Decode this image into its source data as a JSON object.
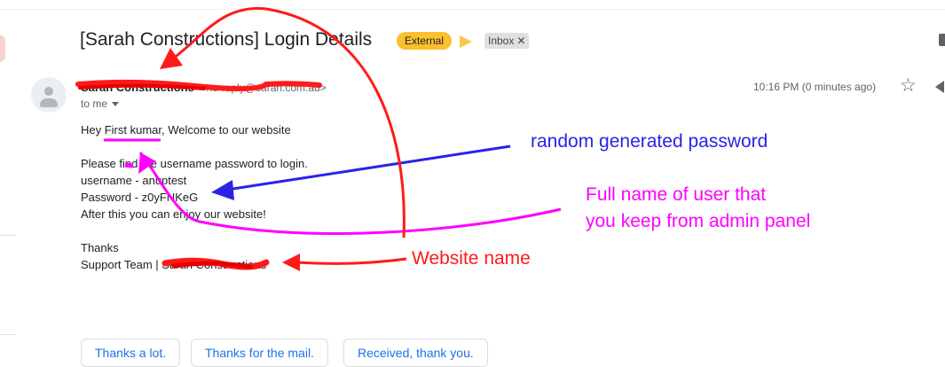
{
  "email": {
    "subject": "[Sarah Constructions] Login Details",
    "labels": {
      "external": "External",
      "inbox": "Inbox"
    },
    "sender_name": "Sarah Constructions",
    "sender_email": "<no-reply@sarah.com.au>",
    "to_line": "to me",
    "timestamp": "10:16 PM (0 minutes ago)",
    "body": {
      "greeting": "Hey First kumar, Welcome to our website",
      "line1": "Please find the username password to login.",
      "username": "username - anuptest",
      "password": "Password - z0yFNKeG",
      "line4": "After this you can enjoy our website!",
      "thanks": "Thanks",
      "signature": "Support Team | Sarah Constructions"
    }
  },
  "smart_replies": [
    "Thanks a lot.",
    "Thanks for the mail.",
    "Received, thank you."
  ],
  "annotations": {
    "blue": "random generated password",
    "pink_line1": "Full name of user that",
    "pink_line2": "you keep from admin panel",
    "red": "Website name"
  },
  "colors": {
    "external_badge": "#fbc02d",
    "annotation_blue": "#2b22e6",
    "annotation_pink": "#ff00ff",
    "annotation_red": "#ff1a1a",
    "link_blue": "#1a73e8"
  }
}
